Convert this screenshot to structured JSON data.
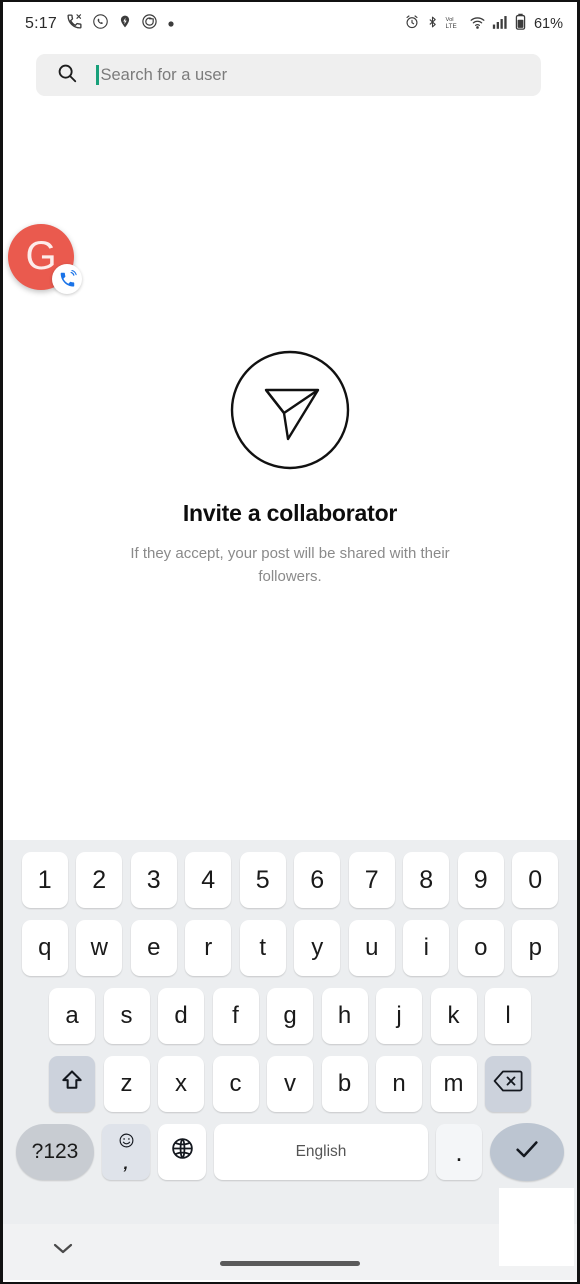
{
  "status_bar": {
    "time": "5:17",
    "left_icons": [
      "missed-call-icon",
      "whatsapp-icon",
      "location-pin-icon",
      "google-icon",
      "dot-icon"
    ],
    "right_icons": [
      "alarm-icon",
      "bluetooth-icon",
      "volte-icon",
      "wifi-icon",
      "signal-icon",
      "battery-icon"
    ],
    "battery_percent": "61%"
  },
  "search": {
    "icon": "search-icon",
    "placeholder": "Search for a user",
    "value": "",
    "cursor_color": "#18a07a",
    "background": "#efefef"
  },
  "call_bubble": {
    "letter": "G",
    "color": "#ea5a4e",
    "badge_icon": "phone-in-call-icon",
    "badge_color": "#1a73e8"
  },
  "empty_state": {
    "icon": "send-plane-circle-icon",
    "title": "Invite a collaborator",
    "subtitle": "If they accept, your post will be shared with their followers."
  },
  "keyboard": {
    "row_numbers": [
      "1",
      "2",
      "3",
      "4",
      "5",
      "6",
      "7",
      "8",
      "9",
      "0"
    ],
    "row_top": [
      "q",
      "w",
      "e",
      "r",
      "t",
      "y",
      "u",
      "i",
      "o",
      "p"
    ],
    "row_home": [
      "a",
      "s",
      "d",
      "f",
      "g",
      "h",
      "j",
      "k",
      "l"
    ],
    "row_bottom": [
      "z",
      "x",
      "c",
      "v",
      "b",
      "n",
      "m"
    ],
    "shift_icon": "shift-arrow-icon",
    "backspace_icon": "backspace-icon",
    "symbols_label": "?123",
    "emoji_icon": "emoji-smiley-icon",
    "comma_label": ",",
    "globe_icon": "globe-language-icon",
    "space_label": "English",
    "period_label": ".",
    "enter_icon": "checkmark-icon",
    "key_color": "#ffffff",
    "mod_key_color": "#ccd2dc",
    "background": "#eceef0"
  },
  "nav_bar": {
    "hide_keyboard_icon": "chevron-down-icon",
    "gesture_bar": "home-gesture-bar"
  }
}
